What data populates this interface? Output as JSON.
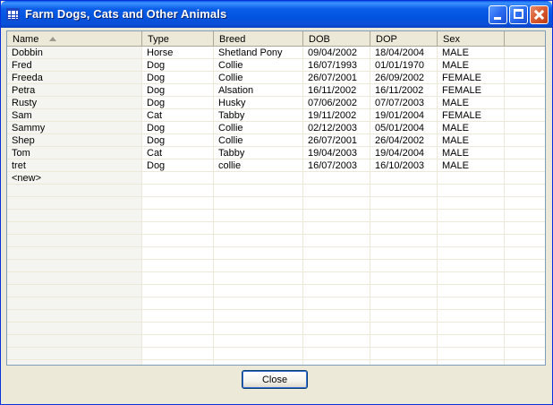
{
  "window": {
    "title": "Farm Dogs, Cats and Other Animals"
  },
  "table": {
    "columns": [
      "Name",
      "Type",
      "Breed",
      "DOB",
      "DOP",
      "Sex"
    ],
    "sorted_column": "Name",
    "rows": [
      [
        "Dobbin",
        "Horse",
        "Shetland Pony",
        "09/04/2002",
        "18/04/2004",
        "MALE"
      ],
      [
        "Fred",
        "Dog",
        "Collie",
        "16/07/1993",
        "01/01/1970",
        "MALE"
      ],
      [
        "Freeda",
        "Dog",
        "Collie",
        "26/07/2001",
        "26/09/2002",
        "FEMALE"
      ],
      [
        "Petra",
        "Dog",
        "Alsation",
        "16/11/2002",
        "16/11/2002",
        "FEMALE"
      ],
      [
        "Rusty",
        "Dog",
        "Husky",
        "07/06/2002",
        "07/07/2003",
        "MALE"
      ],
      [
        "Sam",
        "Cat",
        "Tabby",
        "19/11/2002",
        "19/01/2004",
        "FEMALE"
      ],
      [
        "Sammy",
        "Dog",
        "Collie",
        "02/12/2003",
        "05/01/2004",
        "MALE"
      ],
      [
        "Shep",
        "Dog",
        "Collie",
        "26/07/2001",
        "26/04/2002",
        "MALE"
      ],
      [
        "Tom",
        "Cat",
        "Tabby",
        "19/04/2003",
        "19/04/2004",
        "MALE"
      ],
      [
        "tret",
        "Dog",
        "collie",
        "16/07/2003",
        "16/10/2003",
        "MALE"
      ]
    ],
    "new_row_label": "<new>"
  },
  "buttons": {
    "close_label": "Close"
  },
  "colors": {
    "titlebar": "#0a5ee8",
    "key_column": "#f4f4f0",
    "grid_line": "#ece9d8",
    "face": "#ece9d8"
  }
}
